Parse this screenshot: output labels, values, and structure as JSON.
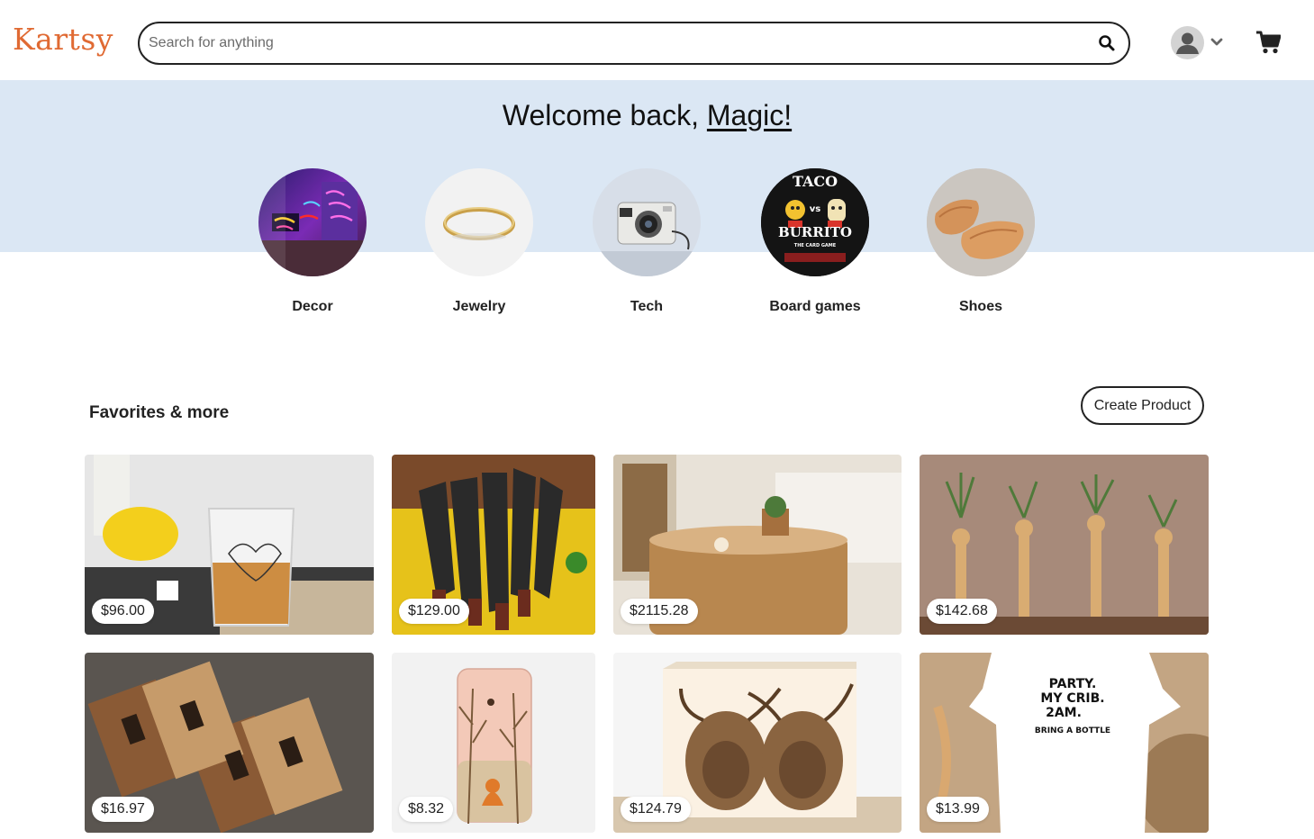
{
  "header": {
    "logo": "Kartsy",
    "search_placeholder": "Search for anything",
    "icons": {
      "search": "search-icon",
      "avatar": "user-avatar-icon",
      "dropdown": "chevron-down-icon",
      "cart": "cart-icon"
    }
  },
  "hero": {
    "welcome_prefix": "Welcome back, ",
    "user_name": "Magic!",
    "categories": [
      {
        "label": "Decor"
      },
      {
        "label": "Jewelry"
      },
      {
        "label": "Tech"
      },
      {
        "label": "Board games"
      },
      {
        "label": "Shoes"
      }
    ],
    "board_game_art": {
      "line1": "TACO",
      "line2": "vs",
      "line3": "BURRITO",
      "line4": "THE CARD GAME"
    }
  },
  "favorites": {
    "title": "Favorites & more",
    "create_button": "Create Product",
    "products": [
      {
        "price": "$96.00"
      },
      {
        "price": "$129.00"
      },
      {
        "price": "$2115.28"
      },
      {
        "price": "$142.68"
      },
      {
        "price": "$16.97"
      },
      {
        "price": "$8.32"
      },
      {
        "price": "$124.79"
      },
      {
        "price": "$13.99",
        "onesie_text": [
          "PARTY.",
          "MY CRIB.",
          "2AM.",
          "BRING A BOTTLE"
        ]
      }
    ]
  },
  "colors": {
    "brand": "#e06a33",
    "hero_bg": "#dbe7f4"
  }
}
